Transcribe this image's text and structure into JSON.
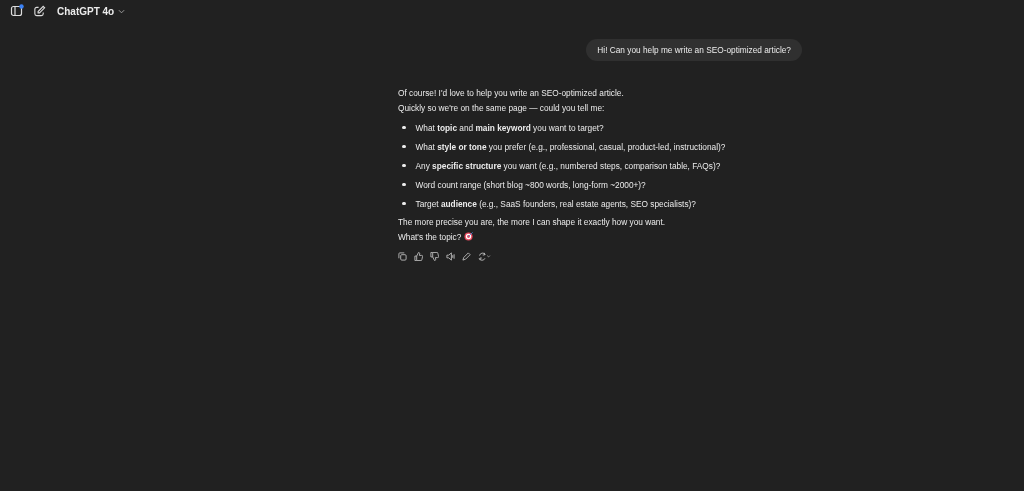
{
  "header": {
    "model": "ChatGPT 4o"
  },
  "user_message": "Hi! Can you help me write an SEO-optimized article?",
  "reply": {
    "intro": [
      "Of course! I'd love to help you write an SEO-optimized article.",
      "Quickly so we're on the same page — could you tell me:"
    ],
    "bullets": [
      "What **topic** and **main keyword** you want to target?",
      "What **style or tone** you prefer (e.g., professional, casual, product-led, instructional)?",
      "Any **specific structure** you want (e.g., numbered steps, comparison table, FAQs)?",
      "Word count range (short blog ~800 words, long-form ~2000+)?",
      "Target **audience** (e.g., SaaS founders, real estate agents, SEO specialists)?"
    ],
    "outro": [
      "The more precise you are, the more I can shape it exactly how you want.",
      "What's the topic?"
    ]
  }
}
